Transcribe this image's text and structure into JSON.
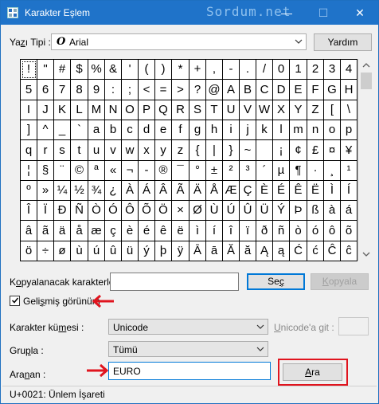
{
  "window": {
    "title": "Karakter Eşlem",
    "watermark": "Sordum.net",
    "minimize_glyph": "—",
    "maximize_glyph": "☐",
    "close_glyph": "✕"
  },
  "font_row": {
    "label_prefix": "Ya",
    "label_underlined": "z",
    "label_suffix": "ı Tipi :",
    "font_icon_glyph": "O",
    "font_name": "Arial",
    "help_button": "Yardım"
  },
  "chars": [
    "!",
    "\"",
    "#",
    "$",
    "%",
    "&",
    "'",
    "(",
    ")",
    "*",
    "+",
    ",",
    "-",
    ".",
    "/",
    "0",
    "1",
    "2",
    "3",
    "4",
    "5",
    "6",
    "7",
    "8",
    "9",
    ":",
    ";",
    "<",
    "=",
    ">",
    "?",
    "@",
    "A",
    "B",
    "C",
    "D",
    "E",
    "F",
    "G",
    "H",
    "I",
    "J",
    "K",
    "L",
    "M",
    "N",
    "O",
    "P",
    "Q",
    "R",
    "S",
    "T",
    "U",
    "V",
    "W",
    "X",
    "Y",
    "Z",
    "[",
    "\\",
    "]",
    "^",
    "_",
    "`",
    "a",
    "b",
    "c",
    "d",
    "e",
    "f",
    "g",
    "h",
    "i",
    "j",
    "k",
    "l",
    "m",
    "n",
    "o",
    "p",
    "q",
    "r",
    "s",
    "t",
    "u",
    "v",
    "w",
    "x",
    "y",
    "z",
    "{",
    "|",
    "}",
    "~",
    " ",
    "¡",
    "¢",
    "£",
    "¤",
    "¥",
    "¦",
    "§",
    "¨",
    "©",
    "ª",
    "«",
    "¬",
    "-",
    "®",
    "¯",
    "°",
    "±",
    "²",
    "³",
    "´",
    "µ",
    "¶",
    "·",
    "¸",
    "¹",
    "º",
    "»",
    "¼",
    "½",
    "¾",
    "¿",
    "À",
    "Á",
    "Â",
    "Ã",
    "Ä",
    "Å",
    "Æ",
    "Ç",
    "È",
    "É",
    "Ê",
    "Ë",
    "Ì",
    "Í",
    "Î",
    "Ï",
    "Ð",
    "Ñ",
    "Ò",
    "Ó",
    "Ô",
    "Õ",
    "Ö",
    "×",
    "Ø",
    "Ù",
    "Ú",
    "Û",
    "Ü",
    "Ý",
    "Þ",
    "ß",
    "à",
    "á",
    "â",
    "ã",
    "ä",
    "å",
    "æ",
    "ç",
    "è",
    "é",
    "ê",
    "ë",
    "ì",
    "í",
    "î",
    "ï",
    "ð",
    "ñ",
    "ò",
    "ó",
    "ô",
    "õ",
    "ö",
    "÷",
    "ø",
    "ù",
    "ú",
    "û",
    "ü",
    "ý",
    "þ",
    "ÿ",
    "Ā",
    "ā",
    "Ă",
    "ă",
    "Ą",
    "ą",
    "Ć",
    "ć",
    "Ĉ",
    "ĉ"
  ],
  "copy_row": {
    "label_prefix": "K",
    "label_underlined": "o",
    "label_suffix": "pyalanacak karakterler :",
    "value": "",
    "select_button_prefix": "Se",
    "select_button_underlined": "ç",
    "select_button_suffix": "",
    "copy_button_prefix": "",
    "copy_button_underlined": "K",
    "copy_button_suffix": "opyala"
  },
  "advanced": {
    "label_prefix": "Geli",
    "label_underlined": "ş",
    "label_suffix": "miş görünüm",
    "checked": true
  },
  "charset_row": {
    "label_prefix": "Karakter kü",
    "label_underlined": "m",
    "label_suffix": "esi :",
    "value": "Unicode",
    "goto_label_prefix": "",
    "goto_label_underlined": "U",
    "goto_label_suffix": "nicode'a git :",
    "goto_value": ""
  },
  "group_row": {
    "label_prefix": "Gru",
    "label_underlined": "p",
    "label_suffix": "la :",
    "value": "Tümü"
  },
  "search_row": {
    "label_prefix": "Ara",
    "label_underlined": "n",
    "label_suffix": "an :",
    "value": "EURO",
    "button_prefix": "",
    "button_underlined": "A",
    "button_suffix": "ra"
  },
  "status": {
    "text": "U+0021: Ünlem İşareti"
  },
  "colors": {
    "titlebar": "#1f73c9",
    "annotation_red": "#e0141e",
    "accent_blue": "#0078d7"
  }
}
